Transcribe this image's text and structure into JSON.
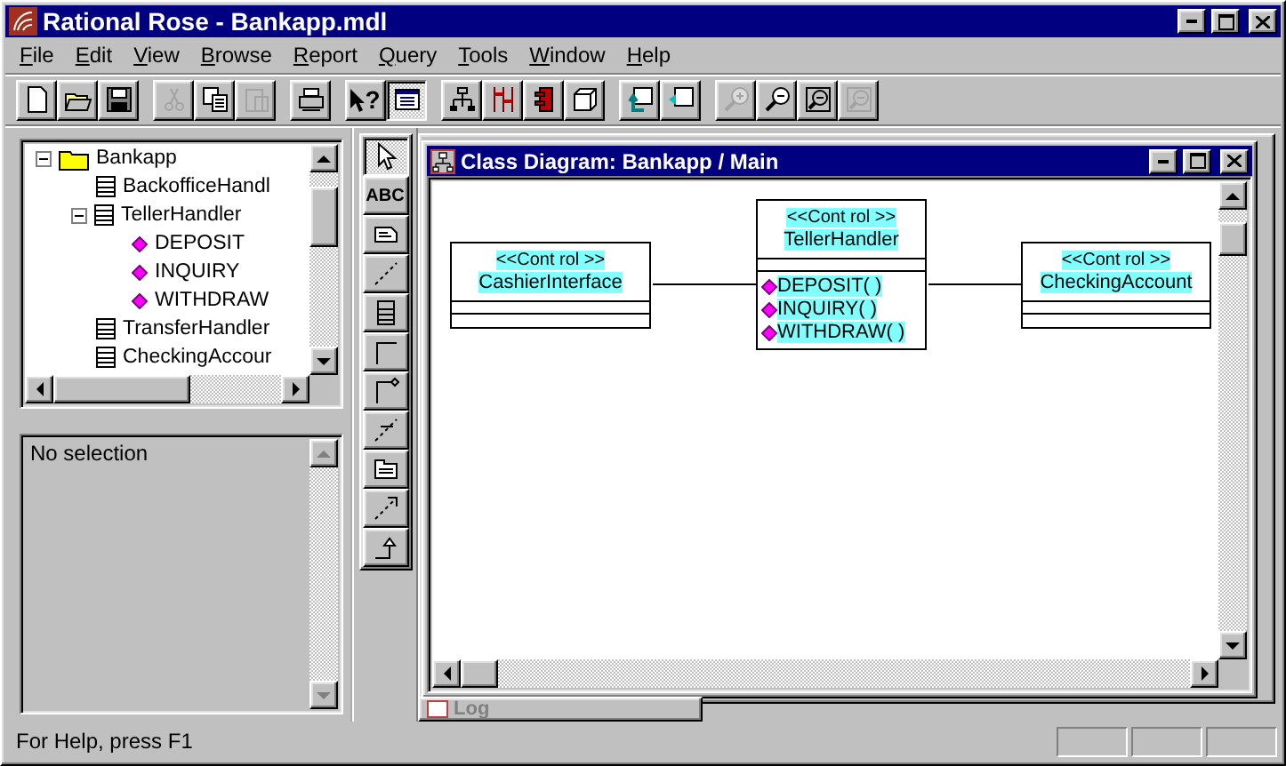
{
  "window": {
    "title": "Rational Rose - Bankapp.mdl"
  },
  "menu": [
    {
      "label": "File"
    },
    {
      "label": "Edit"
    },
    {
      "label": "View"
    },
    {
      "label": "Browse"
    },
    {
      "label": "Report"
    },
    {
      "label": "Query"
    },
    {
      "label": "Tools"
    },
    {
      "label": "Window"
    },
    {
      "label": "Help"
    }
  ],
  "toolbar_groups": [
    {
      "buttons": [
        {
          "kind": "new",
          "disabled": false,
          "pressed": false
        },
        {
          "kind": "open",
          "disabled": false,
          "pressed": false
        },
        {
          "kind": "save",
          "disabled": false,
          "pressed": false
        }
      ]
    },
    {
      "buttons": [
        {
          "kind": "cut",
          "disabled": true,
          "pressed": false
        },
        {
          "kind": "copy",
          "disabled": false,
          "pressed": false
        },
        {
          "kind": "paste",
          "disabled": true,
          "pressed": false
        }
      ]
    },
    {
      "buttons": [
        {
          "kind": "print",
          "disabled": false,
          "pressed": false
        }
      ]
    },
    {
      "buttons": [
        {
          "kind": "help",
          "label": "?",
          "disabled": false,
          "pressed": false
        },
        {
          "kind": "documentation",
          "disabled": false,
          "pressed": true
        }
      ]
    },
    {
      "buttons": [
        {
          "kind": "hierarchy",
          "disabled": false,
          "pressed": false
        },
        {
          "kind": "sequence",
          "disabled": false,
          "pressed": false
        },
        {
          "kind": "component",
          "disabled": false,
          "pressed": false
        },
        {
          "kind": "cube",
          "disabled": false,
          "pressed": false
        }
      ]
    },
    {
      "buttons": [
        {
          "kind": "parent",
          "disabled": false,
          "pressed": false
        },
        {
          "kind": "previous",
          "disabled": false,
          "pressed": false
        }
      ]
    },
    {
      "buttons": [
        {
          "kind": "zoom-in",
          "disabled": true,
          "pressed": false
        },
        {
          "kind": "zoom-out",
          "disabled": false,
          "pressed": false
        },
        {
          "kind": "fit",
          "disabled": false,
          "pressed": false
        },
        {
          "kind": "undo-fit",
          "disabled": true,
          "pressed": false
        }
      ]
    }
  ],
  "browser": {
    "tree": [
      {
        "label": "Bankapp",
        "kind": "package",
        "expanded": true,
        "children": [
          {
            "label": "BackofficeHandl",
            "kind": "class"
          },
          {
            "label": "TellerHandler",
            "kind": "class",
            "expanded": true,
            "children": [
              {
                "label": "DEPOSIT",
                "kind": "operation"
              },
              {
                "label": "INQUIRY",
                "kind": "operation"
              },
              {
                "label": "WITHDRAW",
                "kind": "operation"
              }
            ]
          },
          {
            "label": "TransferHandler",
            "kind": "class"
          },
          {
            "label": "CheckingAccour",
            "kind": "class"
          }
        ]
      }
    ]
  },
  "documentation": {
    "text": "No selection",
    "disabled": true
  },
  "toolbox": [
    {
      "kind": "select",
      "pressed": true
    },
    {
      "kind": "text",
      "label": "ABC",
      "pressed": false
    },
    {
      "kind": "note",
      "pressed": false
    },
    {
      "kind": "anchor",
      "pressed": false
    },
    {
      "kind": "class",
      "pressed": false
    },
    {
      "kind": "association",
      "pressed": false
    },
    {
      "kind": "aggregation",
      "pressed": false
    },
    {
      "kind": "link",
      "pressed": false
    },
    {
      "kind": "package",
      "pressed": false
    },
    {
      "kind": "dependency",
      "pressed": false
    },
    {
      "kind": "generalization",
      "pressed": false
    }
  ],
  "diagram_window": {
    "title": "Class Diagram: Bankapp / Main",
    "classes": [
      {
        "stereotype": "<<Cont rol >>",
        "name": "CashierInterface"
      },
      {
        "stereotype": "<<Cont rol >>",
        "name": "TellerHandler",
        "operations": [
          "DEPOSIT( )",
          "INQUIRY( )",
          "WITHDRAW( )"
        ]
      },
      {
        "stereotype": "<<Cont rol >>",
        "name": "CheckingAccount"
      }
    ]
  },
  "minimized_windows": [
    {
      "title": "Log"
    }
  ],
  "status_bar": {
    "text": "For Help, press F1"
  }
}
